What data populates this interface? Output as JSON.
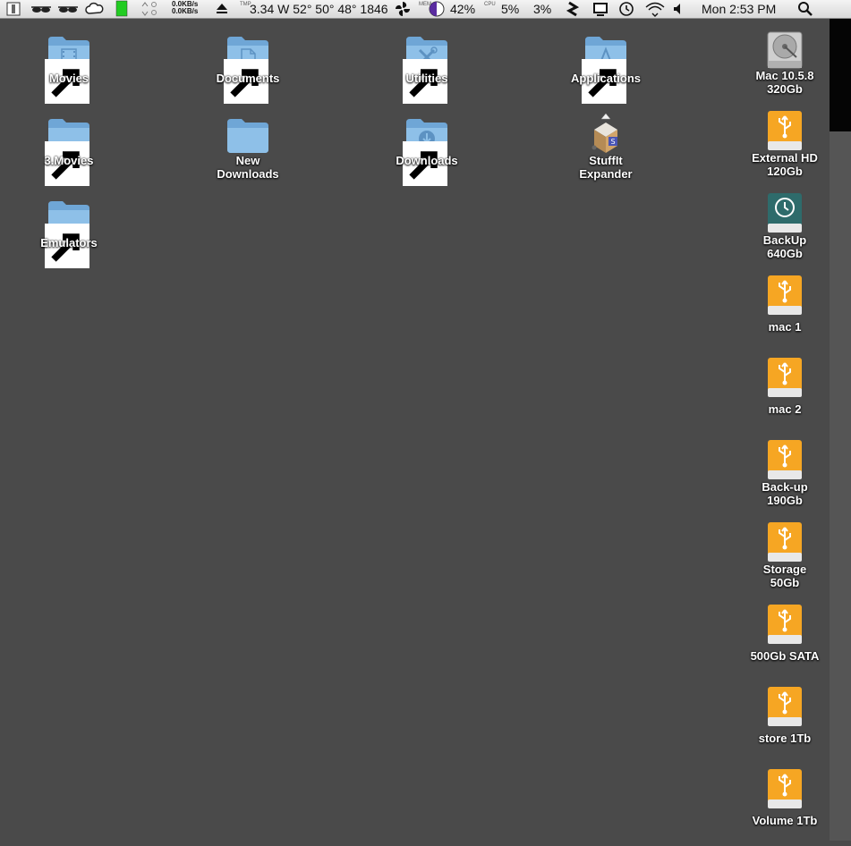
{
  "menubar": {
    "net_up": "0.0KB/s",
    "net_down": "0.0KB/s",
    "temp_label": "TMP",
    "weather": "3.34 W 52° 50° 48° 1846",
    "mem_label": "MEM",
    "mem_value": "42%",
    "cpu_label": "CPU",
    "cpu_value1": "5%",
    "cpu_value2": "3%",
    "clock": "Mon 2:53 PM",
    "icons": [
      "system-monitor-icon",
      "sunglasses-icon",
      "sunglasses-icon",
      "cloud-icon",
      "battery-icon",
      "arrows-icon",
      "eject-icon",
      "fan-icon",
      "memory-pie-icon",
      "dropbox-icon",
      "display-icon",
      "time-machine-icon",
      "wifi-icon",
      "volume-icon",
      "spotlight-icon"
    ]
  },
  "desktop": {
    "folders": [
      {
        "name": "Movies",
        "icon": "movies-folder-icon"
      },
      {
        "name": "Documents",
        "icon": "documents-folder-icon"
      },
      {
        "name": "Utilities",
        "icon": "utilities-folder-icon"
      },
      {
        "name": "Applications",
        "icon": "applications-folder-icon"
      },
      {
        "name": "3.Movies",
        "icon": "folder-icon"
      },
      {
        "name": "New",
        "name2": "Downloads",
        "icon": "folder-icon"
      },
      {
        "name": "Downloads",
        "icon": "downloads-folder-icon"
      },
      {
        "name": "StuffIt",
        "name2": "Expander",
        "icon": "stuffit-expander-icon"
      },
      {
        "name": "Emulators",
        "icon": "folder-icon"
      }
    ],
    "drives": [
      {
        "name": "Mac 10.5.8",
        "name2": "320Gb",
        "icon": "internal-hard-drive-icon"
      },
      {
        "name": "External HD",
        "name2": "120Gb",
        "icon": "usb-drive-icon"
      },
      {
        "name": "BackUp",
        "name2": "640Gb",
        "icon": "time-machine-drive-icon"
      },
      {
        "name": "mac 1",
        "icon": "usb-drive-icon"
      },
      {
        "name": "mac 2",
        "icon": "usb-drive-icon"
      },
      {
        "name": "Back-up",
        "name2": "190Gb",
        "icon": "usb-drive-icon"
      },
      {
        "name": "Storage",
        "name2": "50Gb",
        "icon": "usb-drive-icon"
      },
      {
        "name": "500Gb SATA",
        "icon": "usb-drive-icon"
      },
      {
        "name": "store 1Tb",
        "icon": "usb-drive-icon"
      },
      {
        "name": "Volume 1Tb",
        "icon": "usb-drive-icon"
      }
    ]
  },
  "colors": {
    "desktop": "#4a4a4a",
    "folder_blue": "#7fb4e0",
    "usb_orange": "#f5a623",
    "time_machine_teal": "#2e6b6b"
  }
}
